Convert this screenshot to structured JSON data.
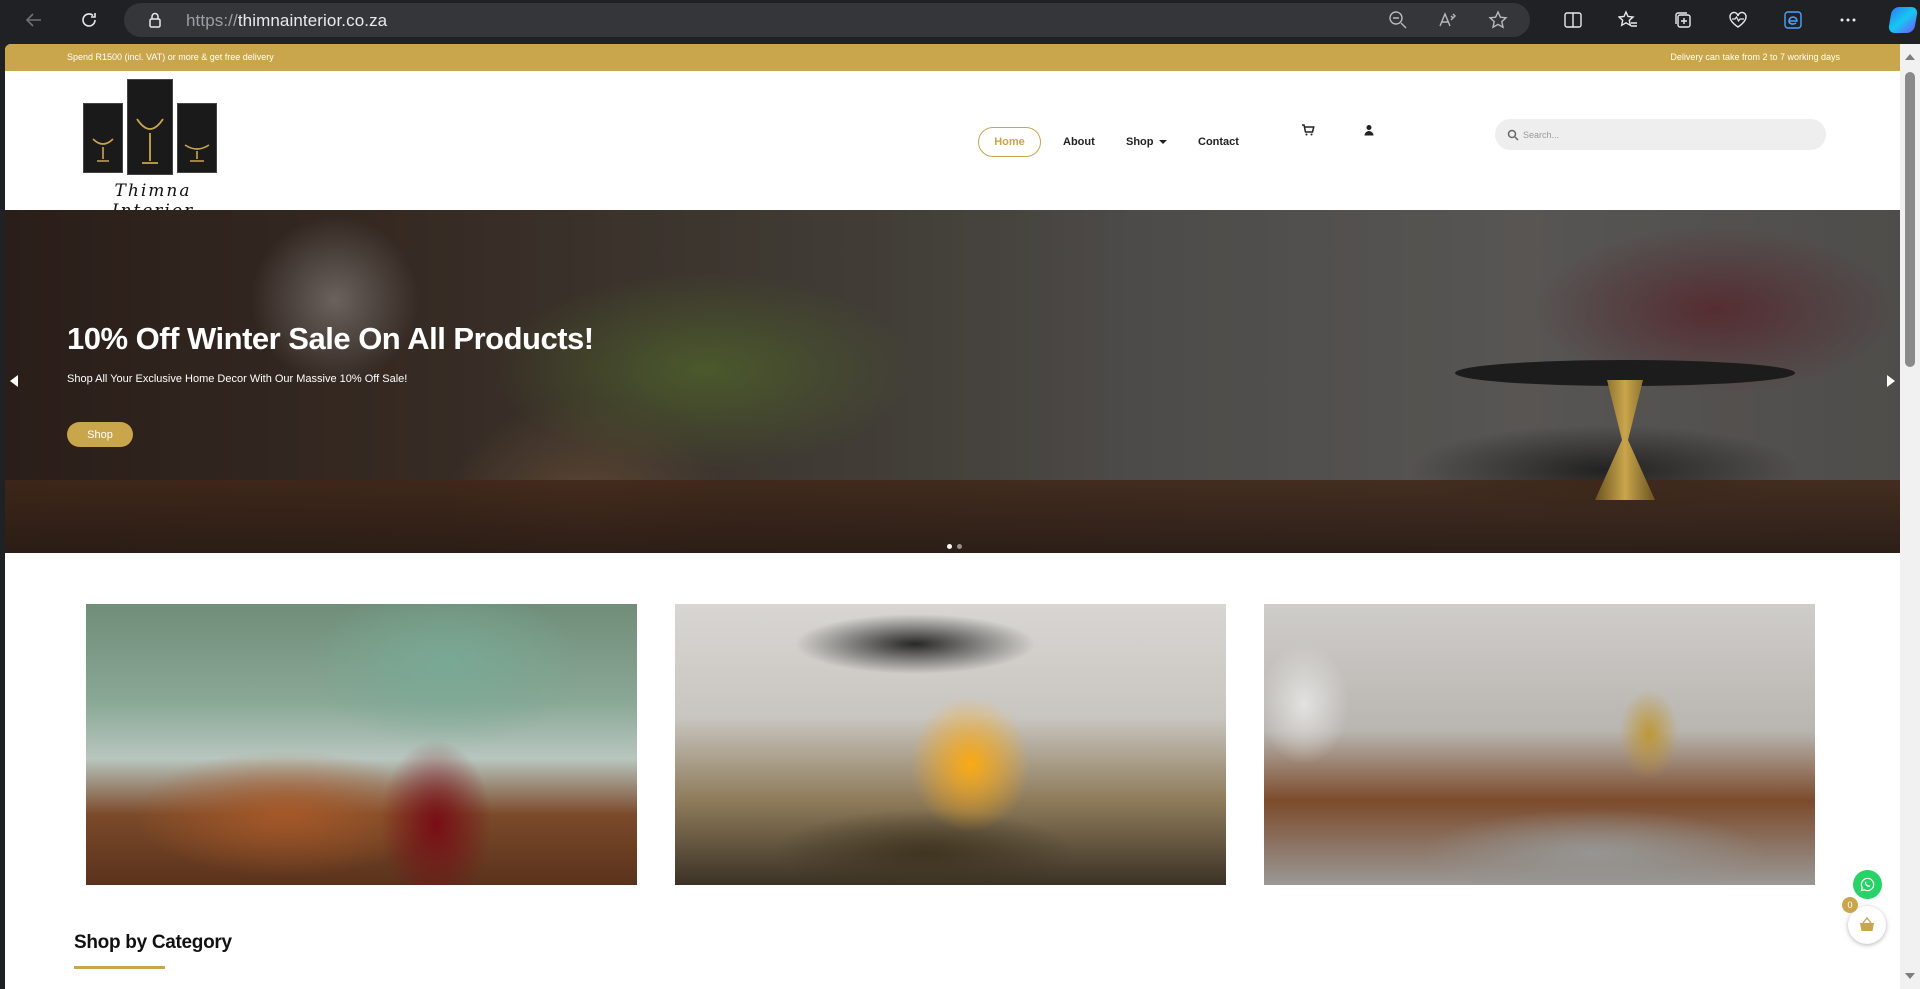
{
  "browser": {
    "url_scheme": "https://",
    "url_host": "thimnainterior.co.za"
  },
  "topbar": {
    "left_text": "Spend R1500 (incl. VAT) or more & get free delivery",
    "right_text": "Delivery can take from 2 to 7 working days"
  },
  "header": {
    "logo_text": "Thimna Interior",
    "nav": {
      "home": "Home",
      "about": "About",
      "shop": "Shop",
      "contact": "Contact"
    },
    "search_placeholder": "Search..."
  },
  "hero": {
    "title": "10% Off Winter Sale On All Products!",
    "subtitle": "Shop All Your Exclusive Home Decor With Our Massive 10% Off Sale!",
    "button_label": "Shop",
    "slides": 2,
    "active_slide": 1
  },
  "section": {
    "title": "Shop by Category"
  },
  "cart_badge": {
    "count": "0"
  },
  "colors": {
    "accent": "#c9a54c",
    "whatsapp": "#25d366"
  },
  "icons": [
    "back-icon",
    "reload-icon",
    "lock-icon",
    "zoom-out-icon",
    "read-aloud-icon",
    "favorite-star-icon",
    "split-screen-icon",
    "favorites-icon",
    "collections-icon",
    "browser-essentials-icon",
    "edge-icon",
    "more-icon",
    "copilot-icon",
    "cart-icon",
    "user-icon",
    "search-icon",
    "whatsapp-icon",
    "basket-icon"
  ]
}
